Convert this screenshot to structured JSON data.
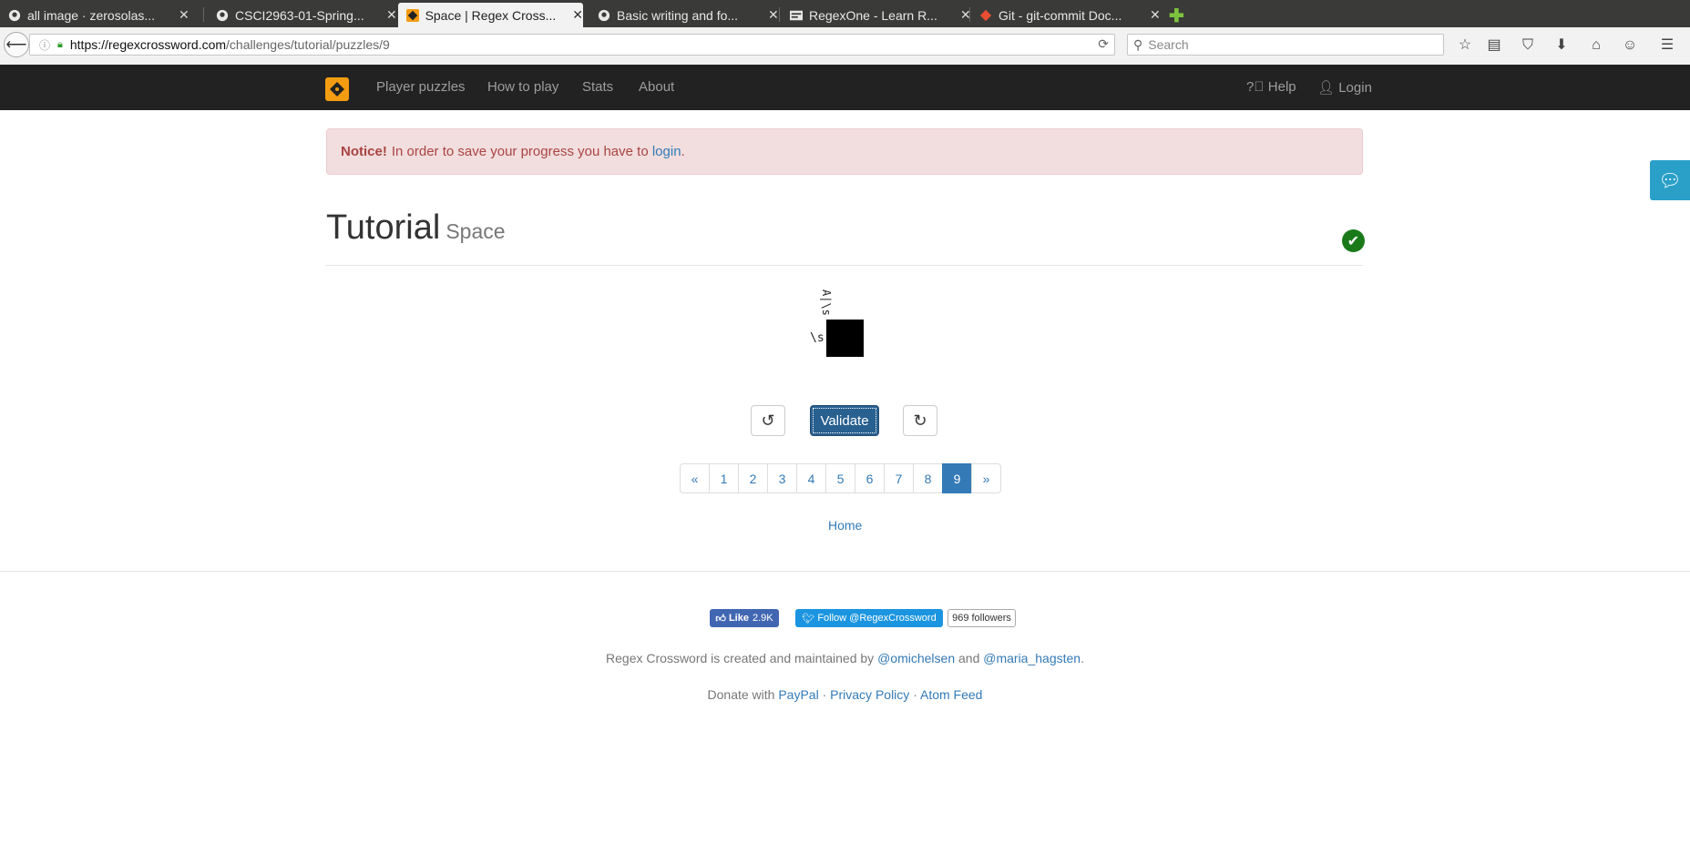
{
  "browser": {
    "tabs": [
      {
        "title": "all image · zerosolas...",
        "icon": "github-icon"
      },
      {
        "title": "CSCI2963-01-Spring...",
        "icon": "github-icon"
      },
      {
        "title": "Space | Regex Cross...",
        "icon": "regexcrossword-icon"
      },
      {
        "title": "Basic writing and fo...",
        "icon": "github-icon"
      },
      {
        "title": "RegexOne - Learn R...",
        "icon": "regexone-icon"
      },
      {
        "title": "Git - git-commit Doc...",
        "icon": "git-icon"
      }
    ],
    "url_host": "https://regexcrossword.com",
    "url_path": "/challenges/tutorial/puzzles/9",
    "search_placeholder": "Search"
  },
  "nav": {
    "left": [
      "Player puzzles",
      "How to play",
      "Stats",
      "About"
    ],
    "help": "Help",
    "login": "Login"
  },
  "notice": {
    "strong": "Notice!",
    "text": "In order to save your progress you have to",
    "link": "login",
    "end": "."
  },
  "page": {
    "title": "Tutorial",
    "subtitle": "Space"
  },
  "puzzle": {
    "column_clue": "A|\\s",
    "row_clue": "\\s"
  },
  "actions": {
    "validate": "Validate"
  },
  "pagination": {
    "prev": "«",
    "pages": [
      "1",
      "2",
      "3",
      "4",
      "5",
      "6",
      "7",
      "8",
      "9"
    ],
    "active": "9",
    "next": "»"
  },
  "home_link": "Home",
  "social": {
    "fb_like": "Like",
    "fb_count": "2.9K",
    "tw_follow": "Follow @RegexCrossword",
    "tw_followers": "969 followers"
  },
  "footer": {
    "credits_pre": "Regex Crossword is created and maintained by",
    "author1": "@omichelsen",
    "and": "and",
    "author2": "@maria_hagsten",
    "dot": ".",
    "donate_pre": "Donate with",
    "paypal": "PayPal",
    "sep": "·",
    "privacy": "Privacy Policy",
    "atom": "Atom Feed"
  }
}
